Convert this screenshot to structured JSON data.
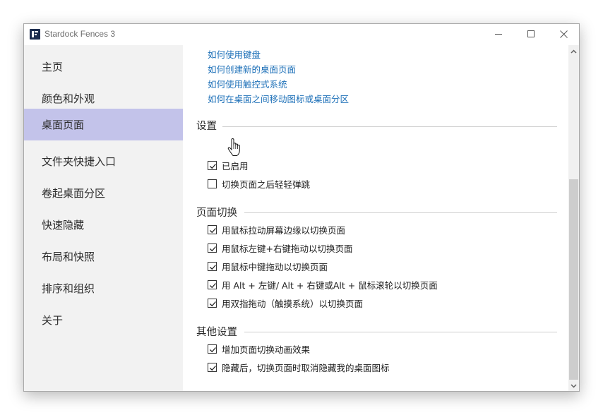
{
  "window": {
    "title": "Stardock Fences 3"
  },
  "sidebar": {
    "items": [
      {
        "label": "主页"
      },
      {
        "label": "颜色和外观"
      },
      {
        "label": "桌面页面"
      },
      {
        "label": "文件夹快捷入口"
      },
      {
        "label": "卷起桌面分区"
      },
      {
        "label": "快速隐藏"
      },
      {
        "label": "布局和快照"
      },
      {
        "label": "排序和组织"
      },
      {
        "label": "关于"
      }
    ],
    "active_index": 2
  },
  "links": [
    {
      "label": "如何使用键盘"
    },
    {
      "label": "如何创建新的桌面页面"
    },
    {
      "label": "如何使用触控式系统"
    },
    {
      "label": "如何在桌面之间移动图标或桌面分区"
    }
  ],
  "sections": {
    "settings": {
      "title": "设置",
      "options": [
        {
          "label": "已启用",
          "checked": true
        },
        {
          "label": "切换页面之后轻轻弹跳",
          "checked": false
        }
      ]
    },
    "page_switch": {
      "title": "页面切换",
      "options": [
        {
          "label": "用鼠标拉动屏幕边缘以切换页面",
          "checked": true
        },
        {
          "label": "用鼠标左键+右键拖动以切换页面",
          "checked": true
        },
        {
          "label": "用鼠标中键拖动以切换页面",
          "checked": true
        },
        {
          "label": "用 Alt + 左键/ Alt + 右键或Alt + 鼠标滚轮以切换页面",
          "checked": true
        },
        {
          "label": "用双指拖动（触摸系统）以切换页面",
          "checked": true
        }
      ]
    },
    "other": {
      "title": "其他设置",
      "options": [
        {
          "label": "增加页面切换动画效果",
          "checked": true
        },
        {
          "label": "隐藏后，切换页面时取消隐藏我的桌面图标",
          "checked": true
        }
      ]
    }
  },
  "colors": {
    "active_nav": "#c3c3ea",
    "link": "#1d70b8",
    "sidebar_bg": "#f2f2f2"
  }
}
